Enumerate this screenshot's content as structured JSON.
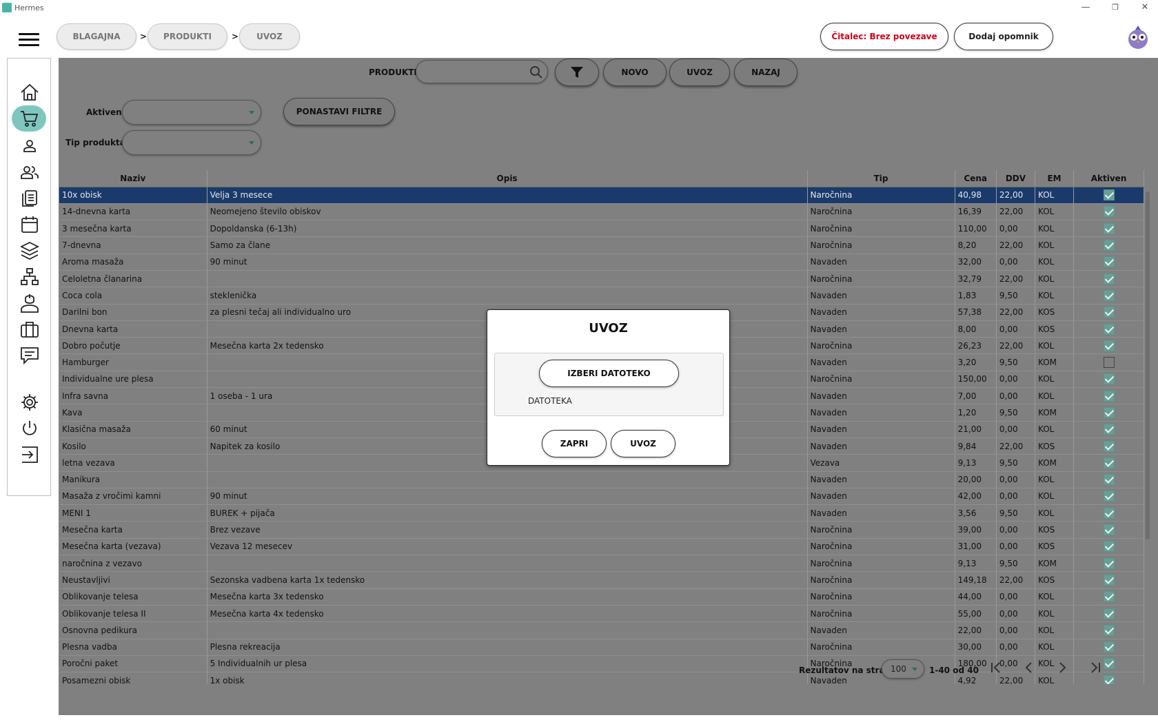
{
  "window": {
    "title": "Hermes",
    "controls": {
      "minimize": "—",
      "restore": "❐",
      "close": "✕"
    }
  },
  "breadcrumb": [
    {
      "label": "BLAGAJNA"
    },
    {
      "label": "PRODUKTI"
    },
    {
      "label": "UVOZ"
    }
  ],
  "breadcrumb_separator": ">",
  "header": {
    "reader_status": "Čitalec: Brez povezave",
    "reader_status_color": "#d0021b",
    "add_reminder": "Dodaj opomnik"
  },
  "sidebar": {
    "accent": "#7fc7be",
    "items": [
      {
        "icon": "home-icon"
      },
      {
        "icon": "cart-icon",
        "active": true
      },
      {
        "icon": "user-icon"
      },
      {
        "icon": "users-icon"
      },
      {
        "icon": "documents-icon"
      },
      {
        "icon": "calendar-icon"
      },
      {
        "icon": "layers-icon"
      },
      {
        "icon": "network-icon"
      },
      {
        "icon": "instructor-icon"
      },
      {
        "icon": "briefcase-icon"
      },
      {
        "icon": "message-icon"
      },
      {
        "icon": "gear-icon"
      },
      {
        "icon": "power-icon"
      },
      {
        "icon": "logout-icon"
      }
    ]
  },
  "toolbar": {
    "section_label": "PRODUKTI",
    "search_value": "",
    "filter_icon": "filter-icon",
    "new_label": "NOVO",
    "import_label": "UVOZ",
    "back_label": "NAZAJ"
  },
  "filters": {
    "active_label": "Aktiven",
    "active_value": "",
    "type_label": "Tip produkta",
    "type_value": "",
    "reset_label": "PONASTAVI FILTRE"
  },
  "table": {
    "columns": [
      "Naziv",
      "Opis",
      "Tip",
      "Cena",
      "DDV",
      "EM",
      "Aktiven"
    ],
    "rows": [
      {
        "naziv": "10x obisk",
        "opis": "Velja 3 mesece",
        "tip": "Naročnina",
        "cena": "40,98",
        "ddv": "22,00",
        "em": "KOL",
        "aktiven": true,
        "selected": true
      },
      {
        "naziv": "14-dnevna karta",
        "opis": "Neomejeno število obiskov",
        "tip": "Naročnina",
        "cena": "16,39",
        "ddv": "22,00",
        "em": "KOL",
        "aktiven": true
      },
      {
        "naziv": "3 mesečna karta",
        "opis": "Dopoldanska (6-13h)",
        "tip": "Naročnina",
        "cena": "110,00",
        "ddv": "0,00",
        "em": "KOL",
        "aktiven": true
      },
      {
        "naziv": "7-dnevna",
        "opis": "Samo za člane",
        "tip": "Naročnina",
        "cena": "8,20",
        "ddv": "22,00",
        "em": "KOL",
        "aktiven": true
      },
      {
        "naziv": "Aroma masaža",
        "opis": "90 minut",
        "tip": "Navaden",
        "cena": "32,00",
        "ddv": "0,00",
        "em": "KOL",
        "aktiven": true
      },
      {
        "naziv": "Celoletna članarina",
        "opis": "",
        "tip": "Naročnina",
        "cena": "32,79",
        "ddv": "22,00",
        "em": "KOL",
        "aktiven": true
      },
      {
        "naziv": "Coca cola",
        "opis": "steklenička",
        "tip": "Navaden",
        "cena": "1,83",
        "ddv": "9,50",
        "em": "KOL",
        "aktiven": true
      },
      {
        "naziv": "Darilni bon",
        "opis": "za plesni tečaj ali individualno uro",
        "tip": "Navaden",
        "cena": "57,38",
        "ddv": "22,00",
        "em": "KOS",
        "aktiven": true
      },
      {
        "naziv": "Dnevna karta",
        "opis": "",
        "tip": "Navaden",
        "cena": "8,00",
        "ddv": "0,00",
        "em": "KOS",
        "aktiven": true
      },
      {
        "naziv": "Dobro počutje",
        "opis": "Mesečna karta 2x tedensko",
        "tip": "Naročnina",
        "cena": "26,23",
        "ddv": "22,00",
        "em": "KOL",
        "aktiven": true
      },
      {
        "naziv": "Hamburger",
        "opis": "",
        "tip": "Navaden",
        "cena": "3,20",
        "ddv": "9,50",
        "em": "KOM",
        "aktiven": false
      },
      {
        "naziv": "Individualne ure plesa",
        "opis": "",
        "tip": "Naročnina",
        "cena": "150,00",
        "ddv": "0,00",
        "em": "KOL",
        "aktiven": true
      },
      {
        "naziv": "Infra savna",
        "opis": "1 oseba - 1 ura",
        "tip": "Navaden",
        "cena": "7,00",
        "ddv": "0,00",
        "em": "KOL",
        "aktiven": true
      },
      {
        "naziv": "Kava",
        "opis": "",
        "tip": "Navaden",
        "cena": "1,20",
        "ddv": "9,50",
        "em": "KOM",
        "aktiven": true
      },
      {
        "naziv": "Klasična masaža",
        "opis": "60 minut",
        "tip": "Navaden",
        "cena": "21,00",
        "ddv": "0,00",
        "em": "KOL",
        "aktiven": true
      },
      {
        "naziv": "Kosilo",
        "opis": "Napitek za kosilo",
        "tip": "Navaden",
        "cena": "9,84",
        "ddv": "22,00",
        "em": "KOS",
        "aktiven": true
      },
      {
        "naziv": "letna vezava",
        "opis": "",
        "tip": "Vezava",
        "cena": "9,13",
        "ddv": "9,50",
        "em": "KOM",
        "aktiven": true
      },
      {
        "naziv": "Manikura",
        "opis": "",
        "tip": "Navaden",
        "cena": "20,00",
        "ddv": "0,00",
        "em": "KOL",
        "aktiven": true
      },
      {
        "naziv": "Masaža z vročimi kamni",
        "opis": "90 minut",
        "tip": "Navaden",
        "cena": "42,00",
        "ddv": "0,00",
        "em": "KOL",
        "aktiven": true
      },
      {
        "naziv": "MENI 1",
        "opis": "BUREK + pijača",
        "tip": "Navaden",
        "cena": "3,56",
        "ddv": "9,50",
        "em": "KOL",
        "aktiven": true
      },
      {
        "naziv": "Mesečna karta",
        "opis": "Brez vezave",
        "tip": "Naročnina",
        "cena": "39,00",
        "ddv": "0,00",
        "em": "KOS",
        "aktiven": true
      },
      {
        "naziv": "Mesečna karta (vezava)",
        "opis": "Vezava 12 mesecev",
        "tip": "Naročnina",
        "cena": "31,00",
        "ddv": "0,00",
        "em": "KOS",
        "aktiven": true
      },
      {
        "naziv": "naročnina z vezavo",
        "opis": "",
        "tip": "Naročnina",
        "cena": "9,13",
        "ddv": "9,50",
        "em": "KOM",
        "aktiven": true
      },
      {
        "naziv": "Neustavljivi",
        "opis": "Sezonska vadbena karta 1x tedensko",
        "tip": "Naročnina",
        "cena": "149,18",
        "ddv": "22,00",
        "em": "KOS",
        "aktiven": true
      },
      {
        "naziv": "Oblikovanje telesa",
        "opis": "Mesečna karta 3x tedensko",
        "tip": "Naročnina",
        "cena": "44,00",
        "ddv": "0,00",
        "em": "KOL",
        "aktiven": true
      },
      {
        "naziv": "Oblikovanje telesa II",
        "opis": "Mesečna karta 4x tedensko",
        "tip": "Naročnina",
        "cena": "55,00",
        "ddv": "0,00",
        "em": "KOL",
        "aktiven": true
      },
      {
        "naziv": "Osnovna pedikura",
        "opis": "",
        "tip": "Navaden",
        "cena": "22,00",
        "ddv": "0,00",
        "em": "KOL",
        "aktiven": true
      },
      {
        "naziv": "Plesna vadba",
        "opis": "Plesna rekreacija",
        "tip": "Naročnina",
        "cena": "30,00",
        "ddv": "0,00",
        "em": "KOL",
        "aktiven": true
      },
      {
        "naziv": "Poročni paket",
        "opis": "5 Individualnih ur plesa",
        "tip": "Naročnina",
        "cena": "180,00",
        "ddv": "0,00",
        "em": "KOL",
        "aktiven": true
      },
      {
        "naziv": "Posamezni obisk",
        "opis": "1x obisk",
        "tip": "Navaden",
        "cena": "4,92",
        "ddv": "22,00",
        "em": "KOL",
        "aktiven": true
      }
    ]
  },
  "footer": {
    "per_page_label": "Rezultatov na stran",
    "per_page_value": "100",
    "range_text": "1-40 od 40",
    "first_icon": "first-page-icon",
    "prev_icon": "prev-page-icon",
    "next_icon": "next-page-icon",
    "last_icon": "last-page-icon"
  },
  "dialog": {
    "title": "UVOZ",
    "choose_file_label": "IZBERI DATOTEKO",
    "file_label": "DATOTEKA",
    "close_label": "ZAPRI",
    "import_label": "UVOZ"
  }
}
